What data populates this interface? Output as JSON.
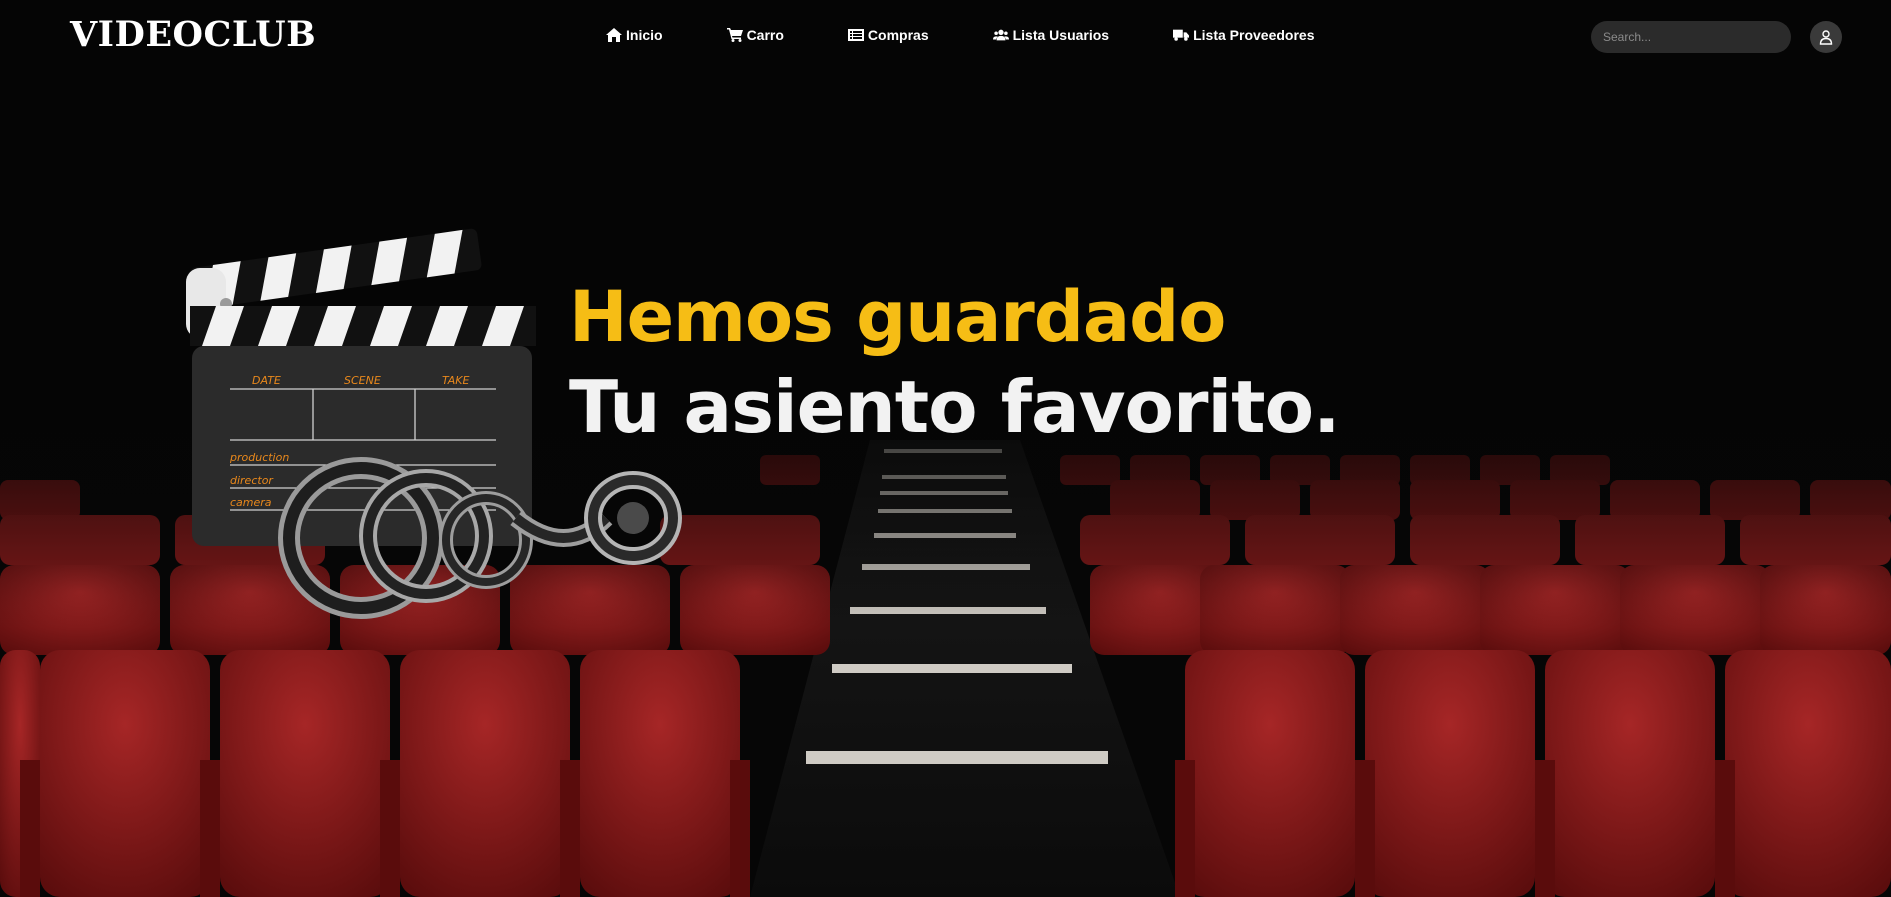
{
  "brand": {
    "title": "VIDEOCLUB"
  },
  "nav": {
    "items": [
      {
        "label": "Inicio",
        "icon": "home-icon"
      },
      {
        "label": "Carro",
        "icon": "cart-icon"
      },
      {
        "label": "Compras",
        "icon": "receipt-icon"
      },
      {
        "label": "Lista Usuarios",
        "icon": "users-icon"
      },
      {
        "label": "Lista Proveedores",
        "icon": "truck-icon"
      }
    ]
  },
  "search": {
    "placeholder": "Search..."
  },
  "user": {
    "icon": "user-icon"
  },
  "hero": {
    "line1": "Hemos guardado",
    "line2": "Tu asiento favorito."
  },
  "clapperboard": {
    "date_label": "DATE",
    "scene_label": "SCENE",
    "take_label": "TAKE",
    "production_label": "production",
    "director_label": "director",
    "camera_label": "camera"
  },
  "colors": {
    "accent": "#f6bd15",
    "seat": "#8c1c1c",
    "background": "#050505"
  }
}
